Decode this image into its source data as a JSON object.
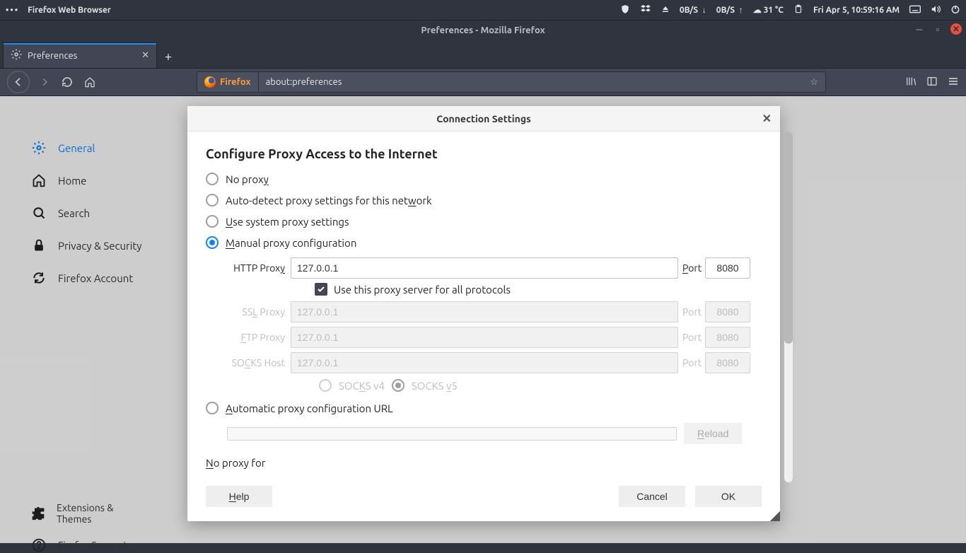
{
  "system_bar": {
    "app_label": "Firefox Web Browser",
    "net_down": "0B/S",
    "net_up": "0B/S",
    "temp": "31 °C",
    "datetime": "Fri Apr  5, 10:59:16 AM"
  },
  "window": {
    "title": "Preferences - Mozilla Firefox"
  },
  "tabs": {
    "active": {
      "label": "Preferences"
    }
  },
  "urlbar": {
    "brand": "Firefox",
    "address": "about:preferences"
  },
  "sidebar": {
    "items": [
      {
        "label": "General"
      },
      {
        "label": "Home"
      },
      {
        "label": "Search"
      },
      {
        "label": "Privacy & Security"
      },
      {
        "label": "Firefox Account"
      }
    ],
    "secondary": [
      {
        "label": "Extensions & Themes"
      },
      {
        "label": "Firefox Support"
      }
    ]
  },
  "dialog": {
    "title": "Connection Settings",
    "heading": "Configure Proxy Access to the Internet",
    "radios": {
      "no_proxy": "No prox",
      "no_proxy_u": "y",
      "auto_detect_pre": "Auto-detect proxy settings for this net",
      "auto_detect_u": "w",
      "auto_detect_post": "ork",
      "system_u": "U",
      "system_post": "se system proxy settings",
      "manual_u": "M",
      "manual_post": "anual proxy configuration",
      "pac_u": "A",
      "pac_post": "utomatic proxy configuration URL"
    },
    "labels": {
      "http": "HTTP Prox",
      "http_u": "y",
      "ssl": "SS",
      "ssl_u": "L",
      "ssl_post": " Proxy",
      "ftp_u": "F",
      "ftp_post": "TP Proxy",
      "socks": "SO",
      "socks_u": "C",
      "socks_post": "KS Host",
      "port_u": "P",
      "port_post": "ort",
      "port_plain": "Port",
      "use_all": "Use this proxy server for all protocols",
      "socks_v4_pre": "SOC",
      "socks_v4_u": "K",
      "socks_v4_post": "S v4",
      "socks_v5_pre": "SOCKS ",
      "socks_v5_u": "v",
      "socks_v5_post": "5",
      "no_proxy_for_u": "N",
      "no_proxy_for_post": "o proxy for"
    },
    "values": {
      "http_host": "127.0.0.1",
      "http_port": "8080",
      "ssl_host": "127.0.0.1",
      "ssl_port": "8080",
      "ftp_host": "127.0.0.1",
      "ftp_port": "8080",
      "socks_host": "127.0.0.1",
      "socks_port": "8080"
    },
    "buttons": {
      "reload_u": "R",
      "reload_post": "eload",
      "help_u": "H",
      "help_post": "elp",
      "cancel": "Cancel",
      "ok": "OK"
    }
  }
}
